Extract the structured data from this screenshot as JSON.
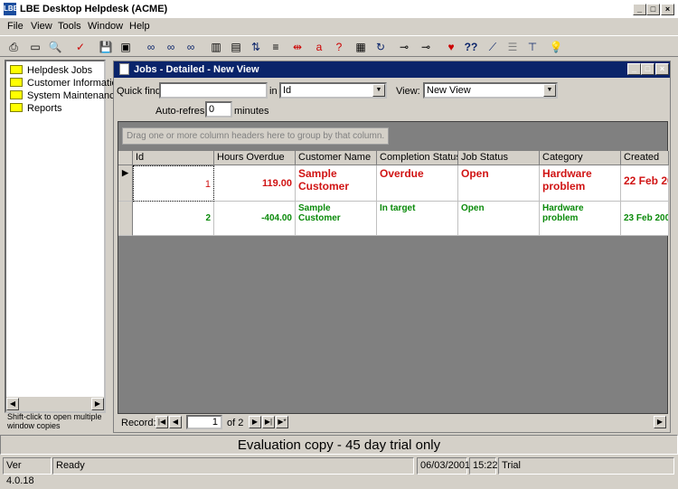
{
  "window": {
    "title": "LBE Desktop Helpdesk (ACME)",
    "icon": "LBE"
  },
  "menu": [
    "File",
    "View",
    "Tools",
    "Window",
    "Help"
  ],
  "toolbar_icons": [
    "print-icon",
    "preview-icon",
    "find-icon",
    "check-icon",
    "save-icon",
    "save-all-icon",
    "binoculars-icon",
    "binoculars-next-icon",
    "binoculars-prev-icon",
    "columns-icon",
    "rows-icon",
    "sort-icon",
    "filter-icon",
    "split-icon",
    "bold-a-icon",
    "question-a-icon",
    "properties-icon",
    "refresh-icon",
    "link-icon",
    "unlink-icon",
    "heart-icon",
    "help-icon",
    "chart-icon",
    "list-icon",
    "tree-icon",
    "lightbulb-icon"
  ],
  "sidebar": {
    "items": [
      {
        "label": "Helpdesk Jobs"
      },
      {
        "label": "Customer Informatio"
      },
      {
        "label": "System Maintenanc"
      },
      {
        "label": "Reports"
      }
    ],
    "hint": "Shift-click to open multiple window copies"
  },
  "child": {
    "title": "Jobs - Detailed - New View",
    "quick_find_label": "Quick find",
    "quick_find_value": "",
    "in_label": "in",
    "in_value": "Id",
    "view_label": "View:",
    "view_value": "New View",
    "autorefresh_label": "Auto-refresh",
    "autorefresh_value": "0",
    "minutes_label": "minutes",
    "group_hint": "Drag one or more column headers here to group by that column.",
    "columns": [
      "Id",
      "Hours Overdue",
      "Customer Name",
      "Completion Status",
      "Job Status",
      "Category",
      "Created"
    ],
    "rows": [
      {
        "id": "1",
        "hours": "119.00",
        "customer": "Sample Customer",
        "completion": "Overdue",
        "status": "Open",
        "category": "Hardware problem",
        "created": "22 Feb 20",
        "color": "#d01414"
      },
      {
        "id": "2",
        "hours": "-404.00",
        "customer": "Sample Customer",
        "completion": "In target",
        "status": "Open",
        "category": "Hardware problem",
        "created": "23 Feb 200",
        "color": "#0a8a0a"
      }
    ],
    "record_label": "Record:",
    "record_value": "1",
    "record_of": "of 2"
  },
  "eval_text": "Evaluation copy - 45 day trial only",
  "status": {
    "version": "Ver 4.0.18",
    "state": "Ready",
    "date": "06/03/2001",
    "time": "15:22",
    "mode": "Trial"
  }
}
